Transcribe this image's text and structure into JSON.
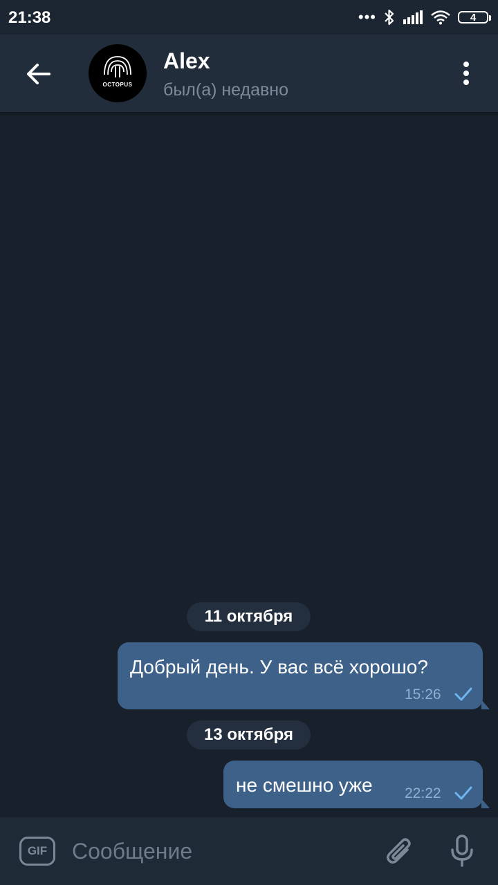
{
  "status_bar": {
    "time": "21:38",
    "dots": "•••",
    "battery_level": "4",
    "icons": [
      "bluetooth-icon",
      "signal-icon",
      "wifi-icon",
      "battery-icon"
    ]
  },
  "header": {
    "contact_name": "Alex",
    "contact_status": "был(а) недавно",
    "avatar_text": "OCTOPUS"
  },
  "messages": [
    {
      "date": "11 октября",
      "text": "Добрый день. У вас всё хорошо?",
      "time": "15:26",
      "status": "sent"
    },
    {
      "date": "13 октября",
      "text": "не смешно уже",
      "time": "22:22",
      "status": "sent"
    }
  ],
  "input": {
    "gif_label": "GIF",
    "placeholder": "Сообщение"
  },
  "colors": {
    "background": "#18202b",
    "header": "#222d3b",
    "outgoing_bubble": "#3e6189",
    "check": "#6fb6f0"
  }
}
